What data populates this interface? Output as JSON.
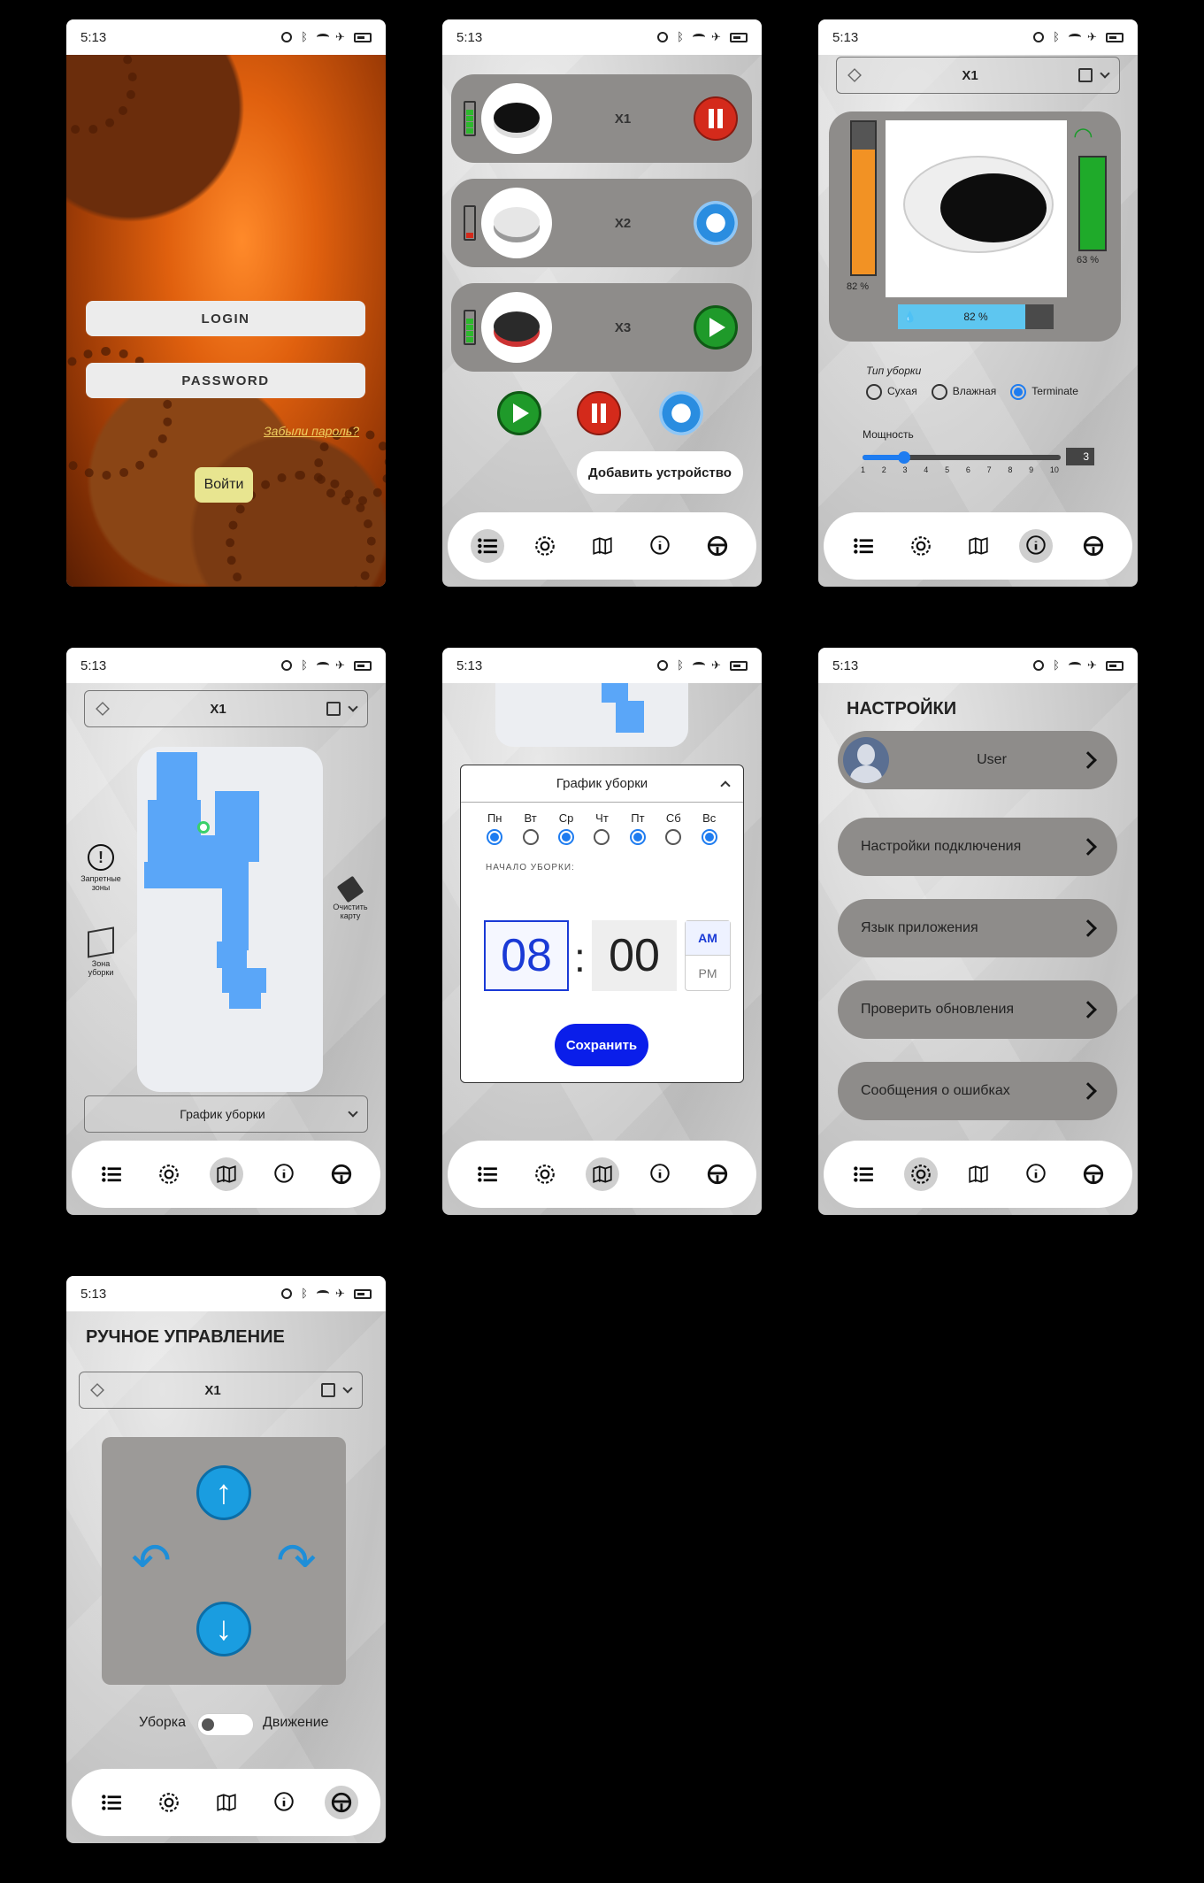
{
  "status": {
    "time": "5:13"
  },
  "login": {
    "login_label": "LOGIN",
    "password_label": "PASSWORD",
    "forgot_label": "Забыли пароль?",
    "enter_label": "Войти"
  },
  "devices": {
    "items": [
      {
        "name": "X1",
        "battery_level": 0.8,
        "action": "pause"
      },
      {
        "name": "X2",
        "battery_level": 0.2,
        "action": "refresh"
      },
      {
        "name": "X3",
        "battery_level": 0.8,
        "action": "play"
      }
    ],
    "add_label": "Добавить устройство"
  },
  "device": {
    "selected": "X1",
    "bin_percent": "82 %",
    "bin_fill": 0.82,
    "battery_percent": "63 %",
    "water_percent": "82 %",
    "clean_type_label": "Тип уборки",
    "clean_types": [
      "Сухая",
      "Влажная",
      "Terminate"
    ],
    "clean_type_selected": 2,
    "power_label": "Мощность",
    "power_ticks": [
      "1",
      "2",
      "3",
      "4",
      "5",
      "6",
      "7",
      "8",
      "9",
      "10"
    ],
    "power_value": "3"
  },
  "map": {
    "forbidden_label": "Запретные зоны",
    "zone_label": "Зона уборки",
    "clear_label": "Очистить карту",
    "schedule_label": "График уборки"
  },
  "schedule": {
    "title": "График уборки",
    "days": [
      {
        "label": "Пн",
        "on": true
      },
      {
        "label": "Вт",
        "on": false
      },
      {
        "label": "Ср",
        "on": true
      },
      {
        "label": "Чт",
        "on": false
      },
      {
        "label": "Пт",
        "on": true
      },
      {
        "label": "Сб",
        "on": false
      },
      {
        "label": "Вс",
        "on": true
      }
    ],
    "start_label": "НАЧАЛО УБОРКИ:",
    "hour": "08",
    "minute": "00",
    "am": "AM",
    "pm": "PM",
    "save_label": "Сохранить"
  },
  "settings": {
    "title": "НАСТРОЙКИ",
    "user": "User",
    "items": [
      "Настройки подключения",
      "Язык приложения",
      "Проверить обновления",
      "Сообщения о ошибках"
    ]
  },
  "manual": {
    "title": "РУЧНОЕ УПРАВЛЕНИЕ",
    "left_label": "Уборка",
    "right_label": "Движение"
  },
  "nav": {
    "icons": [
      "list-icon",
      "settings-icon",
      "map-icon",
      "info-icon",
      "steering-icon"
    ]
  },
  "colors": {
    "accent": "#1e7cf0",
    "card": "#8e8c8a",
    "save": "#0a1eea",
    "bin": "#f29224",
    "water": "#5ec6f0"
  }
}
